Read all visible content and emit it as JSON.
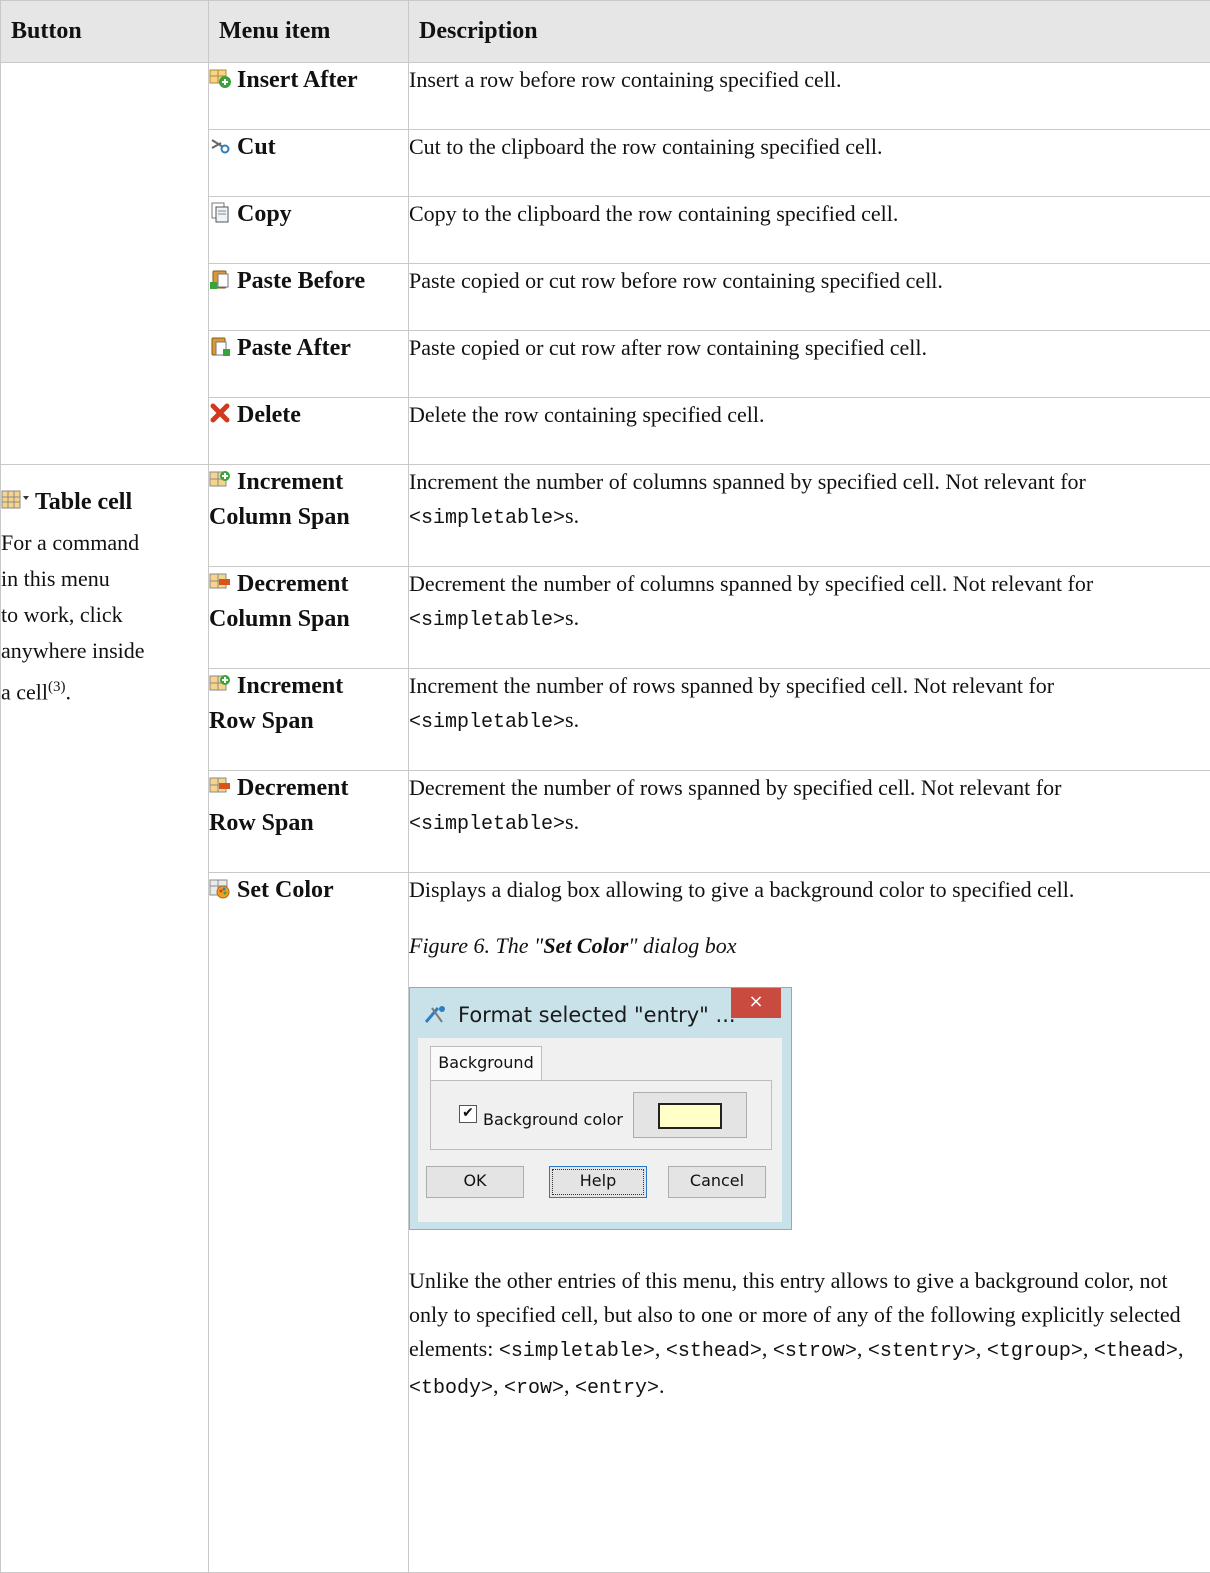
{
  "headers": {
    "button": "Button",
    "menu_item": "Menu item",
    "description": "Description"
  },
  "row_group": [
    {
      "label": "Insert After",
      "icon": "insert-after-icon",
      "desc": "Insert a row before row containing specified cell."
    },
    {
      "label": "Cut",
      "icon": "cut-icon",
      "desc": "Cut to the clipboard the row containing specified cell."
    },
    {
      "label": "Copy",
      "icon": "copy-icon",
      "desc": "Copy to the clipboard the row containing specified cell."
    },
    {
      "label": "Paste Before",
      "icon": "paste-before-icon",
      "desc": "Paste copied or cut row before row containing specified cell."
    },
    {
      "label": "Paste After",
      "icon": "paste-after-icon",
      "desc": "Paste copied or cut row after row containing specified cell."
    },
    {
      "label": "Delete",
      "icon": "delete-icon",
      "desc": "Delete the row containing specified cell."
    }
  ],
  "table_cell": {
    "button_label": "Table cell",
    "button_desc_l1": "For a command",
    "button_desc_l2": "in this menu",
    "button_desc_l3": "to work, click",
    "button_desc_l4": "anywhere inside",
    "button_desc_l5": "a cell",
    "footnote": "(3)",
    "period": ".",
    "items": [
      {
        "label_l1": "Increment",
        "label_l2": "Column Span",
        "icon": "increment-column-span-icon",
        "desc": "Increment the number of columns spanned by specified cell. Not relevant for ",
        "code": "<simpletable>",
        "tail": "s."
      },
      {
        "label_l1": "Decrement",
        "label_l2": "Column Span",
        "icon": "decrement-column-span-icon",
        "desc": "Decrement the number of columns spanned by specified cell. Not relevant for ",
        "code": "<simpletable>",
        "tail": "s."
      },
      {
        "label_l1": "Increment",
        "label_l2": "Row Span",
        "icon": "increment-row-span-icon",
        "desc": "Increment the number of rows spanned by specified cell. Not relevant for ",
        "code": "<simpletable>",
        "tail": "s."
      },
      {
        "label_l1": "Decrement",
        "label_l2": "Row Span",
        "icon": "decrement-row-span-icon",
        "desc": "Decrement the number of rows spanned by specified cell. Not relevant for ",
        "code": "<simpletable>",
        "tail": "s."
      }
    ],
    "set_color": {
      "label": "Set Color",
      "icon": "set-color-icon",
      "desc": "Displays a dialog box allowing to give a background color to specified cell.",
      "caption_pre": "Figure 6. The \"",
      "caption_bold": "Set Color",
      "caption_post": "\" dialog box",
      "dialog": {
        "title": "Format selected \"entry\" ...",
        "close": "×",
        "tab": "Background",
        "checkbox_label": "Background color",
        "checked": true,
        "swatch_color": "#ffffc8",
        "ok": "OK",
        "help": "Help",
        "cancel": "Cancel"
      },
      "unlike_text": "Unlike the other entries of this menu, this entry allows to give a background color, not only to specified cell, but also to one or more of any of the following explicitly selected elements: ",
      "elements": [
        "<simpletable>",
        "<sthead>",
        "<strow>",
        "<stentry>",
        "<tgroup>",
        "<thead>",
        "<tbody>",
        "<row>",
        "<entry>"
      ],
      "end": "."
    }
  }
}
